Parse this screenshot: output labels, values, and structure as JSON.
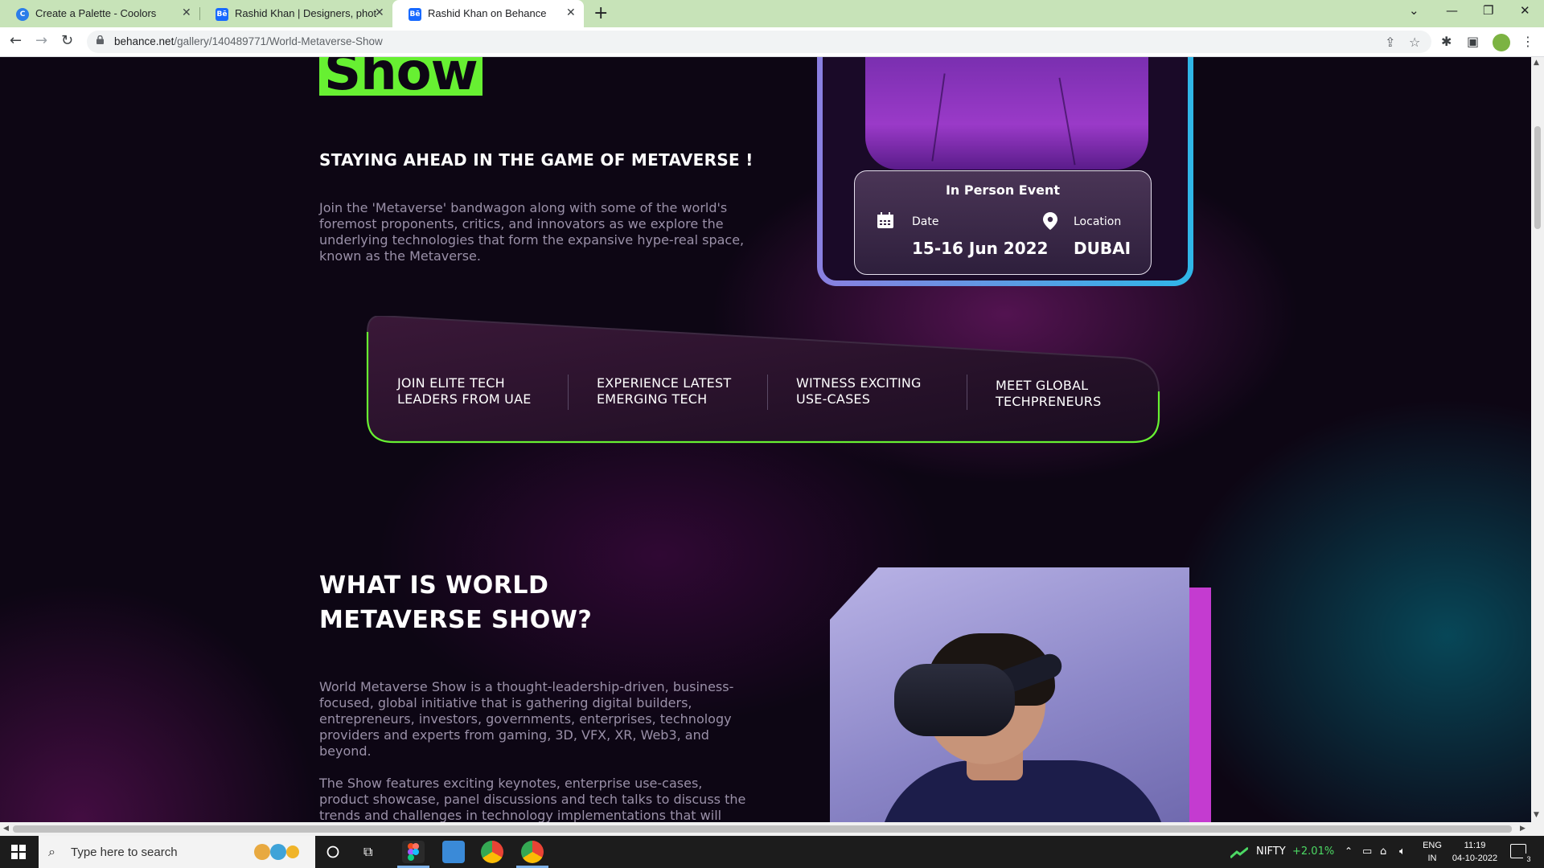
{
  "browser": {
    "tabs": [
      {
        "title": "Create a Palette - Coolors",
        "favicon": "C",
        "favicon_color": "#2b7de9"
      },
      {
        "title": "Rashid Khan | Designers, photog",
        "favicon": "Bē",
        "favicon_color": "#1769ff"
      },
      {
        "title": "Rashid Khan on Behance",
        "favicon": "Bē",
        "favicon_color": "#1769ff",
        "active": true
      }
    ],
    "close_glyph": "✕",
    "new_tab_glyph": "+",
    "url_host": "behance.net",
    "url_path": "/gallery/140489771/World-Metaverse-Show"
  },
  "page": {
    "show_title": "Show",
    "tagline": "STAYING AHEAD IN THE GAME OF METAVERSE !",
    "intro": "Join the 'Metaverse' bandwagon along with some of the world's foremost proponents, critics, and innovators as we explore the underlying technologies that form the expansive hype-real space, known as the Metaverse.",
    "event": {
      "title": "In Person Event",
      "date_label": "Date",
      "date_value": "15-16 Jun 2022",
      "location_label": "Location",
      "location_value": "DUBAI"
    },
    "features": [
      {
        "line1": "JOIN ELITE TECH",
        "line2": "LEADERS FROM UAE"
      },
      {
        "line1": "EXPERIENCE LATEST",
        "line2": "EMERGING TECH"
      },
      {
        "line1": "WITNESS EXCITING",
        "line2": "USE-CASES"
      },
      {
        "line1": "MEET GLOBAL",
        "line2": "TECHPRENEURS"
      }
    ],
    "what_title_line1": "WHAT IS WORLD",
    "what_title_line2": "METAVERSE SHOW?",
    "what_p1": "World Metaverse Show is a thought-leadership-driven, business-focused, global initiative that is gathering digital builders, entrepreneurs, investors, governments, enterprises, technology providers and experts from gaming, 3D, VFX, XR, Web3, and beyond.",
    "what_p2": "The Show features exciting keynotes, enterprise use-cases, product showcase, panel discussions and tech talks to discuss the trends and challenges in technology implementations that will eventually"
  },
  "taskbar": {
    "search_placeholder": "Type here to search",
    "stock_name": "NIFTY",
    "stock_change": "+2.01%",
    "lang_line1": "ENG",
    "lang_line2": "IN",
    "time": "11:19",
    "date": "04-10-2022",
    "notification_count": "3"
  },
  "colors": {
    "tab_strip": "#c7e3b8",
    "accent_green": "#67f032",
    "page_bg": "#0d0614",
    "stock_up": "#4cd964"
  }
}
